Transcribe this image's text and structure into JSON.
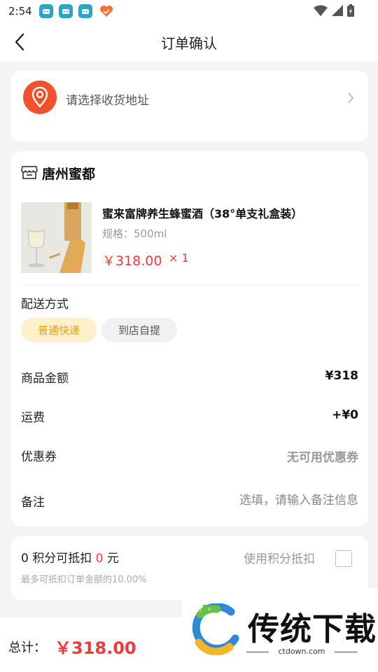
{
  "status_bar": {
    "time": "2:54"
  },
  "nav": {
    "title": "订单确认"
  },
  "address": {
    "placeholder_text": "请选择收货地址"
  },
  "shop": {
    "name": "唐州蜜都"
  },
  "product": {
    "title": "蜜来富牌养生蜂蜜酒（38°单支礼盒装）",
    "spec": "规格：500ml",
    "price": "￥318.00",
    "quantity": "× 1"
  },
  "delivery": {
    "label": "配送方式",
    "options": [
      "普通快递",
      "到店自提"
    ],
    "selected": "普通快递"
  },
  "summary": {
    "goods_amount_label": "商品金额",
    "goods_amount_value": "¥318",
    "shipping_label": "运费",
    "shipping_value": "+¥0",
    "coupon_label": "优惠券",
    "coupon_value": "无可用优惠券",
    "remark_label": "备注",
    "remark_placeholder": "选填，请输入备注信息"
  },
  "points": {
    "count": "0",
    "text_mid": " 积分可抵扣 ",
    "deduct_amount": "0",
    "unit": " 元",
    "note": "最多可抵扣订单金额的10.00%",
    "use_label": "使用积分抵扣",
    "checked": false
  },
  "bottom": {
    "total_label": "总计：",
    "total_value": "￥318.00"
  },
  "watermark": {
    "brand": "传统下载",
    "domain": "ctdown.com"
  },
  "colors": {
    "accent_red": "#f03a3a",
    "address_icon": "#f2512d",
    "chip_active_bg": "#fff0cc",
    "chip_active_text": "#e9a11a"
  }
}
